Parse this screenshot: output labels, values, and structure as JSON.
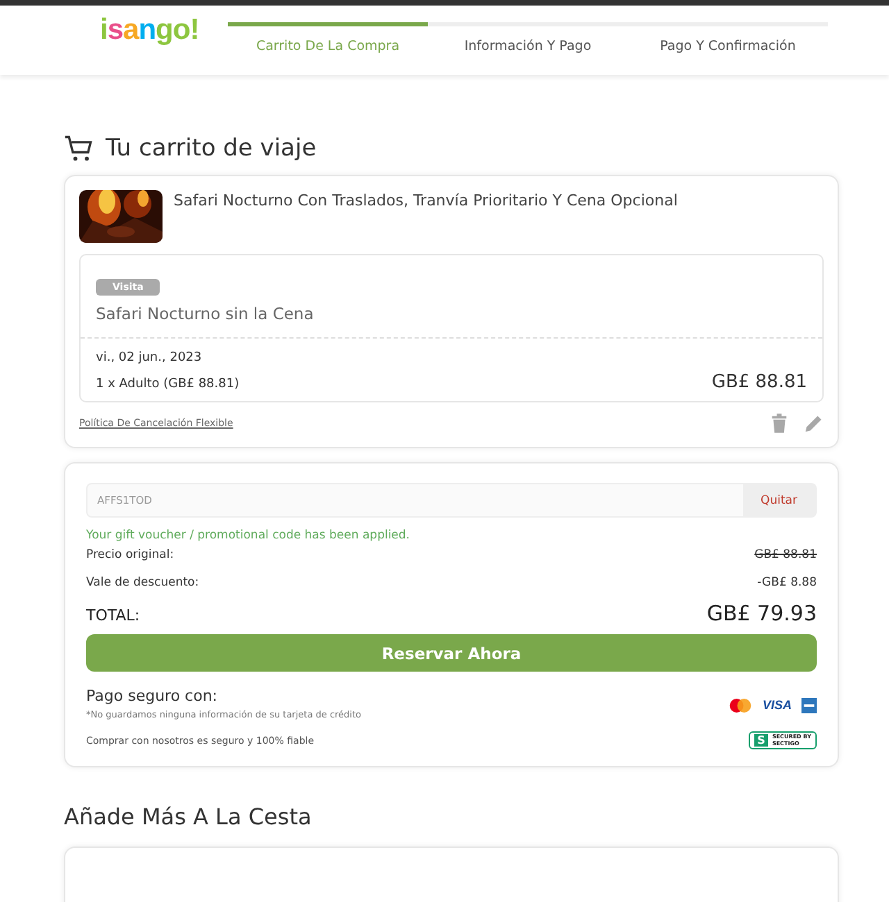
{
  "header": {
    "logo": "isango!",
    "steps": [
      {
        "label": "Carrito De La Compra",
        "selected": true
      },
      {
        "label": "Información Y Pago",
        "selected": false
      },
      {
        "label": "Pago Y Confirmación",
        "selected": false
      }
    ]
  },
  "cart": {
    "title": "Tu carrito de viaje",
    "item": {
      "name": "Safari Nocturno Con Traslados, Tranvía Prioritario Y Cena Opcional",
      "tag": "Visita",
      "option": "Safari Nocturno sin la Cena",
      "date": "vi., 02 jun., 2023",
      "pax": "1 x Adulto (GB£ 88.81)",
      "price": "GB£ 88.81",
      "policy_link": "Política De Cancelación Flexible"
    }
  },
  "summary": {
    "promo_code": "AFFS1TOD",
    "remove_button": "Quitar",
    "applied_message": "Your gift voucher / promotional code has been applied.",
    "lines": [
      {
        "label": "Precio original:",
        "value": "GB£ 88.81",
        "struck": true
      },
      {
        "label": "Vale de descuento:",
        "value": "-GB£ 8.88",
        "struck": false
      }
    ],
    "total_label": "TOTAL:",
    "total_value": "GB£ 79.93",
    "book_button": "Reservar Ahora",
    "secure_title": "Pago seguro con:",
    "secure_note": "*No guardamos ninguna información de su tarjeta de crédito",
    "visa": "VISA",
    "trust_text": "Comprar con nosotros es seguro y 100% fiable",
    "seal": {
      "mark": "S",
      "top": "SECURED BY",
      "bottom": "SECTIGO"
    }
  },
  "more": {
    "title": "Añade Más A La Cesta"
  }
}
